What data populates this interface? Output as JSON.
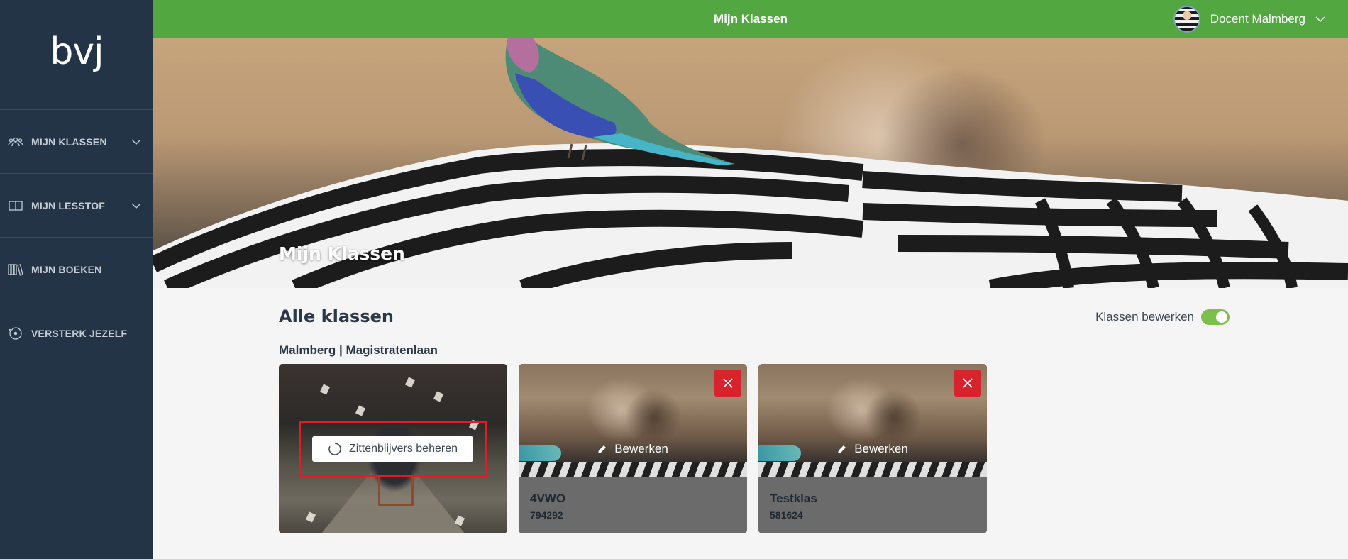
{
  "sidebar": {
    "logo": "bvj",
    "items": [
      {
        "label": "MIJN KLASSEN",
        "icon": "users-icon",
        "has_chevron": true
      },
      {
        "label": "MIJN LESSTOF",
        "icon": "book-open-icon",
        "has_chevron": true
      },
      {
        "label": "MIJN BOEKEN",
        "icon": "bookshelf-icon",
        "has_chevron": false
      },
      {
        "label": "VERSTERK JEZELF",
        "icon": "compass-icon",
        "has_chevron": false
      }
    ]
  },
  "topbar": {
    "title": "Mijn Klassen",
    "user_name": "Docent Malmberg"
  },
  "hero": {
    "title": "Mijn Klassen"
  },
  "main": {
    "section_title": "Alle klassen",
    "toggle_label": "Klassen bewerken",
    "toggle_on": true,
    "school": "Malmberg | Magistratenlaan",
    "manage_label": "Zittenblijvers beheren",
    "edit_label": "Bewerken",
    "classes": [
      {
        "name": "4VWO",
        "code": "794292"
      },
      {
        "name": "Testklas",
        "code": "581624"
      }
    ]
  },
  "colors": {
    "sidebar_bg": "#233447",
    "topbar_bg": "#52a741",
    "toggle_on": "#7cc04b",
    "delete_red": "#d7232c",
    "highlight_red": "#e31b23"
  }
}
